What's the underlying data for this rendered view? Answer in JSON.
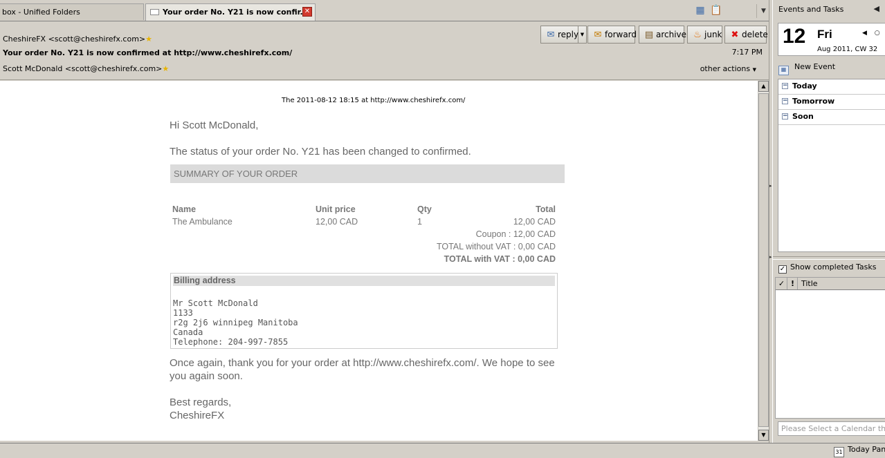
{
  "tabs": [
    {
      "label": "box - Unified Folders",
      "active": false
    },
    {
      "label": "Your order No. Y21 is now confir...",
      "active": true
    }
  ],
  "header": {
    "from": "CheshireFX <scott@cheshirefx.com>",
    "subject": "Your order No. Y21 is now confirmed at http://www.cheshirefx.com/",
    "to": "Scott McDonald <scott@cheshirefx.com>",
    "time": "7:17 PM",
    "other_actions": "other actions",
    "buttons": {
      "reply": "reply",
      "forward": "forward",
      "archive": "archive",
      "junk": "junk",
      "delete": "delete"
    }
  },
  "message": {
    "date_line": "The 2011-08-12 18:15 at http://www.cheshirefx.com/",
    "greeting": "Hi Scott McDonald,",
    "status": "The status of your order No. Y21 has been changed to confirmed.",
    "summary_title": "SUMMARY OF YOUR ORDER",
    "table": {
      "headers": [
        "Name",
        "Unit price",
        "Qty",
        "Total"
      ],
      "rows": [
        [
          "The Ambulance",
          "12,00 CAD",
          "1",
          "12,00 CAD"
        ]
      ],
      "coupon": "Coupon : 12,00 CAD",
      "total_without_vat": "TOTAL without VAT : 0,00 CAD",
      "total_with_vat": "TOTAL with VAT : 0,00 CAD"
    },
    "billing": {
      "title": "Billing address",
      "lines": [
        "Mr Scott McDonald",
        "1133",
        "r2g 2j6 winnipeg Manitoba",
        "Canada",
        "Telephone: 204-997-7855"
      ]
    },
    "thanks": "Once again, thank you for your order at http://www.cheshirefx.com/. We hope to see you again soon.",
    "regards": "Best regards,",
    "signature": "CheshireFX"
  },
  "today_pane": {
    "title": "Events and Tasks",
    "calendar": {
      "day": "12",
      "weekday": "Fri",
      "sub": "Aug 2011, CW 32"
    },
    "new_event": "New Event",
    "agenda": [
      "Today",
      "Tomorrow",
      "Soon"
    ],
    "show_completed": "Show completed Tasks",
    "tasks_title_col": "Title",
    "calendar_select_placeholder": "Please Select a Calendar that S"
  },
  "statusbar": {
    "today_pane": "Today Pan"
  }
}
